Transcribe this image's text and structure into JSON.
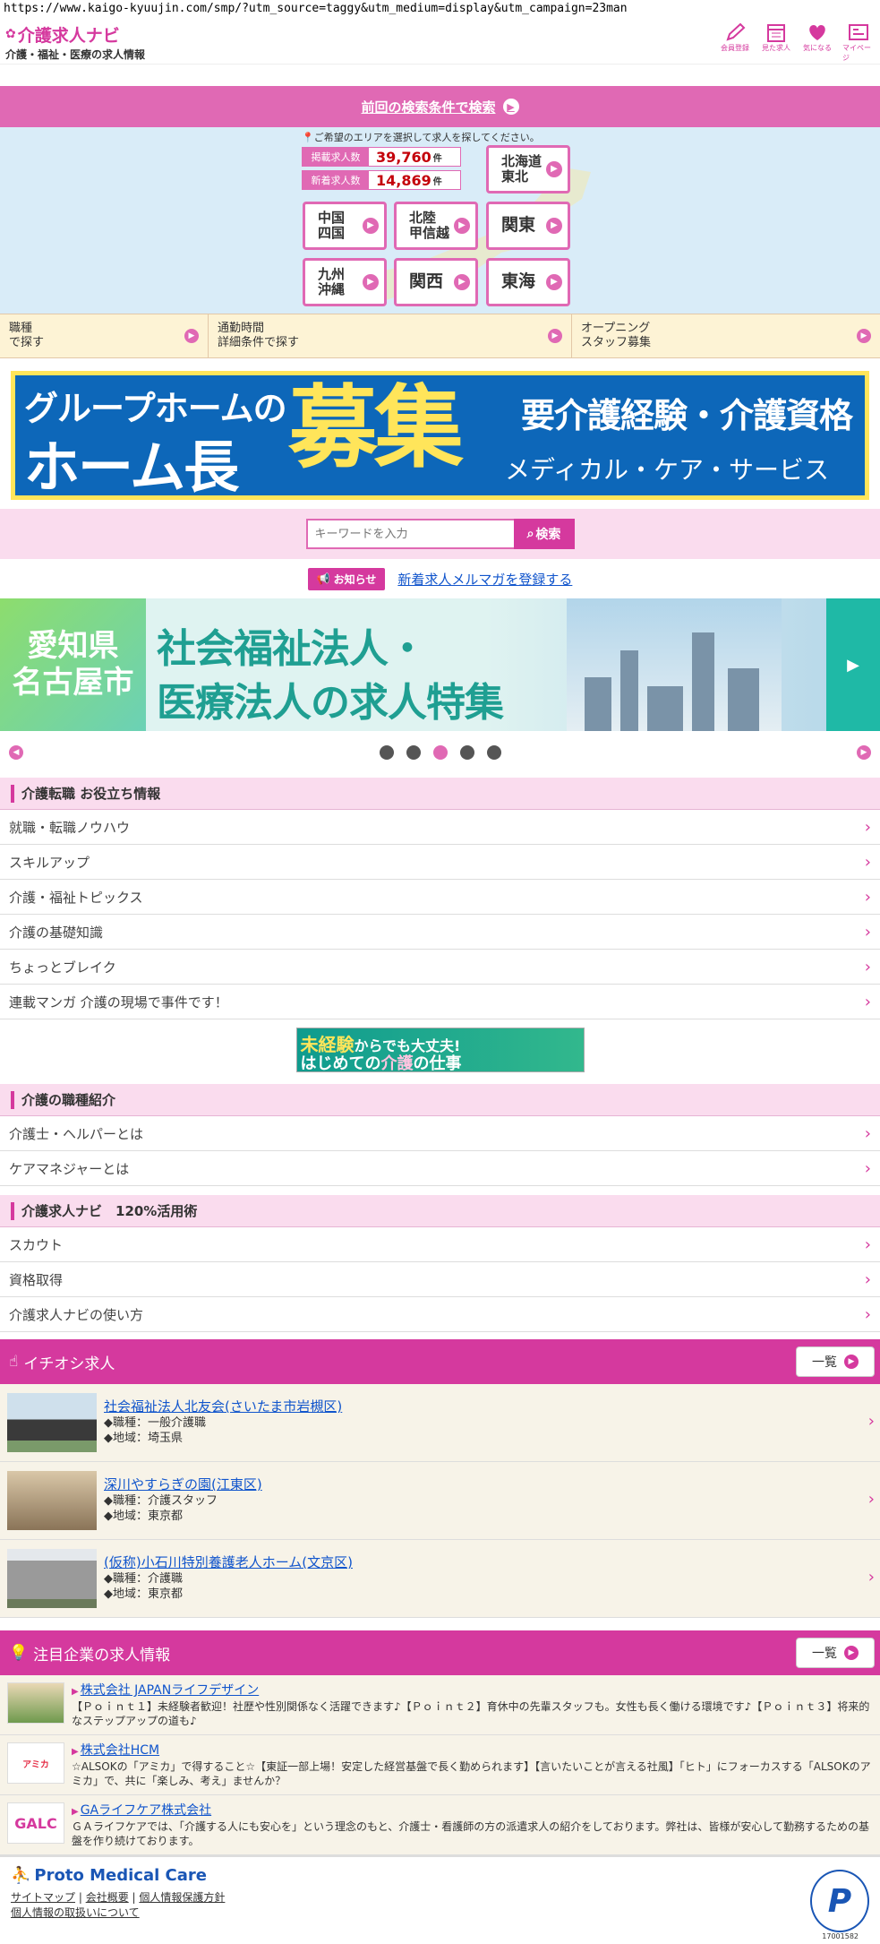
{
  "url": "https://www.kaigo-kyuujin.com/smp/?utm_source=taggy&utm_medium=display&utm_campaign=23man",
  "header": {
    "logo_main": "介護求人ナビ",
    "logo_sub": "介護・福祉・医療の求人情報",
    "icons": [
      {
        "label": "会員登録",
        "icon": "pen-icon"
      },
      {
        "label": "見た求人",
        "icon": "calendar-icon"
      },
      {
        "label": "気になる",
        "icon": "heart-icon"
      },
      {
        "label": "マイページ",
        "icon": "mypage-icon"
      }
    ]
  },
  "prev_search": "前回の検索条件で検索",
  "map": {
    "hint": "ご希望のエリアを選択して求人を探してください。",
    "stats": [
      {
        "label": "掲載求人数",
        "value": "39,760",
        "unit": "件"
      },
      {
        "label": "新着求人数",
        "value": "14,869",
        "unit": "件"
      }
    ],
    "regions": [
      "北海道\n東北",
      "中国\n四国",
      "北陸\n甲信越",
      "関東",
      "九州\n沖縄",
      "関西",
      "東海"
    ]
  },
  "filters": [
    "職種\nで探す",
    "通勤時間\n詳細条件で探す",
    "オープニング\nスタッフ募集"
  ],
  "banner1": {
    "line1": "グループホームの",
    "line2": "ホーム長",
    "big": "募集",
    "right1": "要介護経験・介護資格",
    "right2": "メディカル・ケア・サービス"
  },
  "search": {
    "placeholder": "キーワードを入力",
    "button": "検索"
  },
  "news": {
    "badge": "お知らせ",
    "link": "新着求人メルマガを登録する"
  },
  "banner2": {
    "left": "愛知県\n名古屋市",
    "t1": "社会福祉法人・",
    "t2": "医療法人の求人特集"
  },
  "sections": [
    {
      "title": "介護転職 お役立ち情報",
      "items": [
        "就職・転職ノウハウ",
        "スキルアップ",
        "介護・福祉トピックス",
        "介護の基礎知識",
        "ちょっとブレイク",
        "連載マンガ 介護の現場で事件です！"
      ]
    },
    {
      "title": "介護の職種紹介",
      "items": [
        "介護士・ヘルパーとは",
        "ケアマネジャーとは"
      ]
    },
    {
      "title": "介護求人ナビ　120%活用術",
      "items": [
        "スカウト",
        "資格取得",
        "介護求人ナビの使い方"
      ]
    }
  ],
  "mini_banner": {
    "m1a": "未経験",
    "m1b": "からでも大丈夫!",
    "m2a": "はじめての",
    "m2b": "介護",
    "m2c": "の仕事"
  },
  "pickup": {
    "title": "イチオシ求人",
    "list_btn": "一覧",
    "jobs": [
      {
        "name": "社会福祉法人北友会(さいたま市岩槻区)",
        "type": "◆職種：一般介護職",
        "area": "◆地域：埼玉県"
      },
      {
        "name": "深川やすらぎの園(江東区)",
        "type": "◆職種：介護スタッフ",
        "area": "◆地域：東京都"
      },
      {
        "name": "(仮称)小石川特別養護老人ホーム(文京区)",
        "type": "◆職種：介護職",
        "area": "◆地域：東京都"
      }
    ]
  },
  "featured": {
    "title": "注目企業の求人情報",
    "list_btn": "一覧",
    "corps": [
      {
        "name": "株式会社 JAPANライフデザイン",
        "desc": "【Ｐｏｉｎｔ１】未経験者歓迎！社歴や性別関係なく活躍できます♪【Ｐｏｉｎｔ２】育休中の先輩スタッフも。女性も長く働ける環境です♪【Ｐｏｉｎｔ３】将来的なステップアップの道も♪",
        "logo": ""
      },
      {
        "name": "株式会社HCM",
        "desc": "☆ALSOKの「アミカ」で得すること☆【東証一部上場！安定した経営基盤で長く勤められます】【言いたいことが言える社風】「ヒト」にフォーカスする「ALSOKのアミカ」で、共に「楽しみ、考え」ませんか？",
        "logo": "アミカ"
      },
      {
        "name": "GAライフケア株式会社",
        "desc": "ＧＡライフケアでは、「介護する人にも安心を」という理念のもと、介護士・看護師の方の派遣求人の紹介をしております。弊社は、皆様が安心して勤務するための基盤を作り続けております。",
        "logo": "GALC"
      }
    ]
  },
  "footer": {
    "brand": "Proto Medical Care",
    "links": [
      "サイトマップ",
      "会社概要",
      "個人情報保護方針"
    ],
    "link2": "個人情報の取扱いについて",
    "privacy_num": "17001582"
  }
}
